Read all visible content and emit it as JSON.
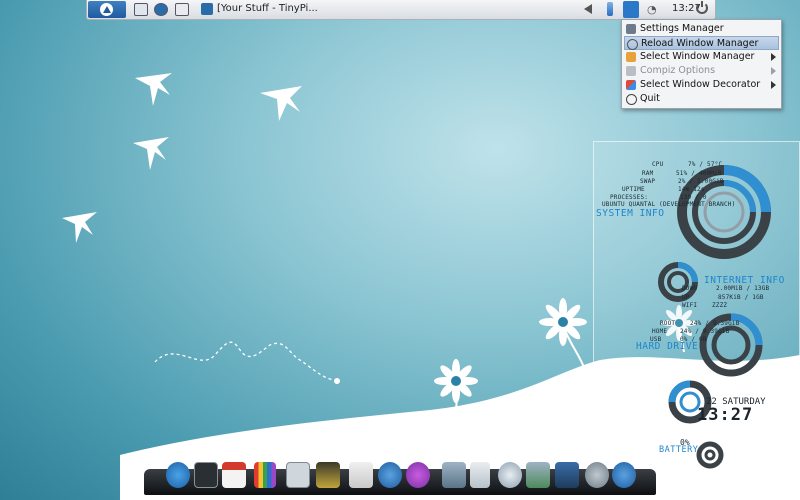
{
  "top_panel": {
    "window_title": "[Your Stuff - TinyPi...",
    "clock": "13:27",
    "icons": [
      "start-menu-icon",
      "show-desktop-icon",
      "browser-icon",
      "window-switch-icon",
      "volume-icon",
      "battery-icon",
      "desktop-tool-icon",
      "wifi-icon",
      "power-icon"
    ]
  },
  "context_menu": {
    "items": [
      {
        "label": "Settings Manager",
        "icon": "settings-icon",
        "state": "normal",
        "submenu": false
      },
      {
        "label": "Reload Window Manager",
        "icon": "reload-icon",
        "state": "highlighted",
        "submenu": false
      },
      {
        "label": "Select Window Manager",
        "icon": "window-manager-icon",
        "state": "normal",
        "submenu": true
      },
      {
        "label": "Compiz Options",
        "icon": "compiz-icon",
        "state": "disabled",
        "submenu": true
      },
      {
        "label": "Select Window Decorator",
        "icon": "decorator-icon",
        "state": "normal",
        "submenu": true
      },
      {
        "label": "Quit",
        "icon": "quit-icon",
        "state": "normal",
        "submenu": false
      }
    ]
  },
  "conky": {
    "system_info": {
      "title": "SYSTEM INFO",
      "rows": [
        {
          "label": "CPU",
          "value": "7% / 57°C"
        },
        {
          "label": "RAM",
          "value": "51% / 400MiB"
        },
        {
          "label": "SWAP",
          "value": "2% / 1.00GiB"
        },
        {
          "label": "UPTIME",
          "value": "14m 12s"
        },
        {
          "label": "PROCESSES:",
          "value": "139 / 0"
        },
        {
          "label": "UBUNTU QUANTAL (DEVELOPMENT BRANCH)",
          "value": ""
        }
      ]
    },
    "internet_info": {
      "title": "INTERNET INFO",
      "rows": [
        {
          "label": "DOWN",
          "value": "2.00MiB / 13GB"
        },
        {
          "label": "UP",
          "value": "857KiB / 1GB"
        },
        {
          "label": "WIFI",
          "value": "ZZZZ"
        }
      ]
    },
    "hard_drive": {
      "title": "HARD DRIVE",
      "rows": [
        {
          "label": "ROOT",
          "value": "24% / 9.39GiB"
        },
        {
          "label": "HOME",
          "value": "24% / 9.39GiB"
        },
        {
          "label": "USB",
          "value": "0% / 0B"
        }
      ]
    },
    "date": "22 SATURDAY",
    "time": "13:27",
    "battery_percent": "0%",
    "battery_label": "BATTERY"
  },
  "colors": {
    "accent_blue": "#1e86cc",
    "ring_dark": "#2a3138",
    "menu_highlight": "#b4c9e3"
  },
  "dock": {
    "items": [
      "launcher-icon",
      "terminal-icon",
      "calendar-icon",
      "pencils-icon",
      "calculator-icon",
      "image-editor-icon",
      "mail-icon",
      "browser-icon",
      "notification-icon",
      "folder-icon",
      "files-icon",
      "clock-icon",
      "download-icon",
      "monitor-icon",
      "refresh-icon",
      "accessibility-icon"
    ]
  }
}
